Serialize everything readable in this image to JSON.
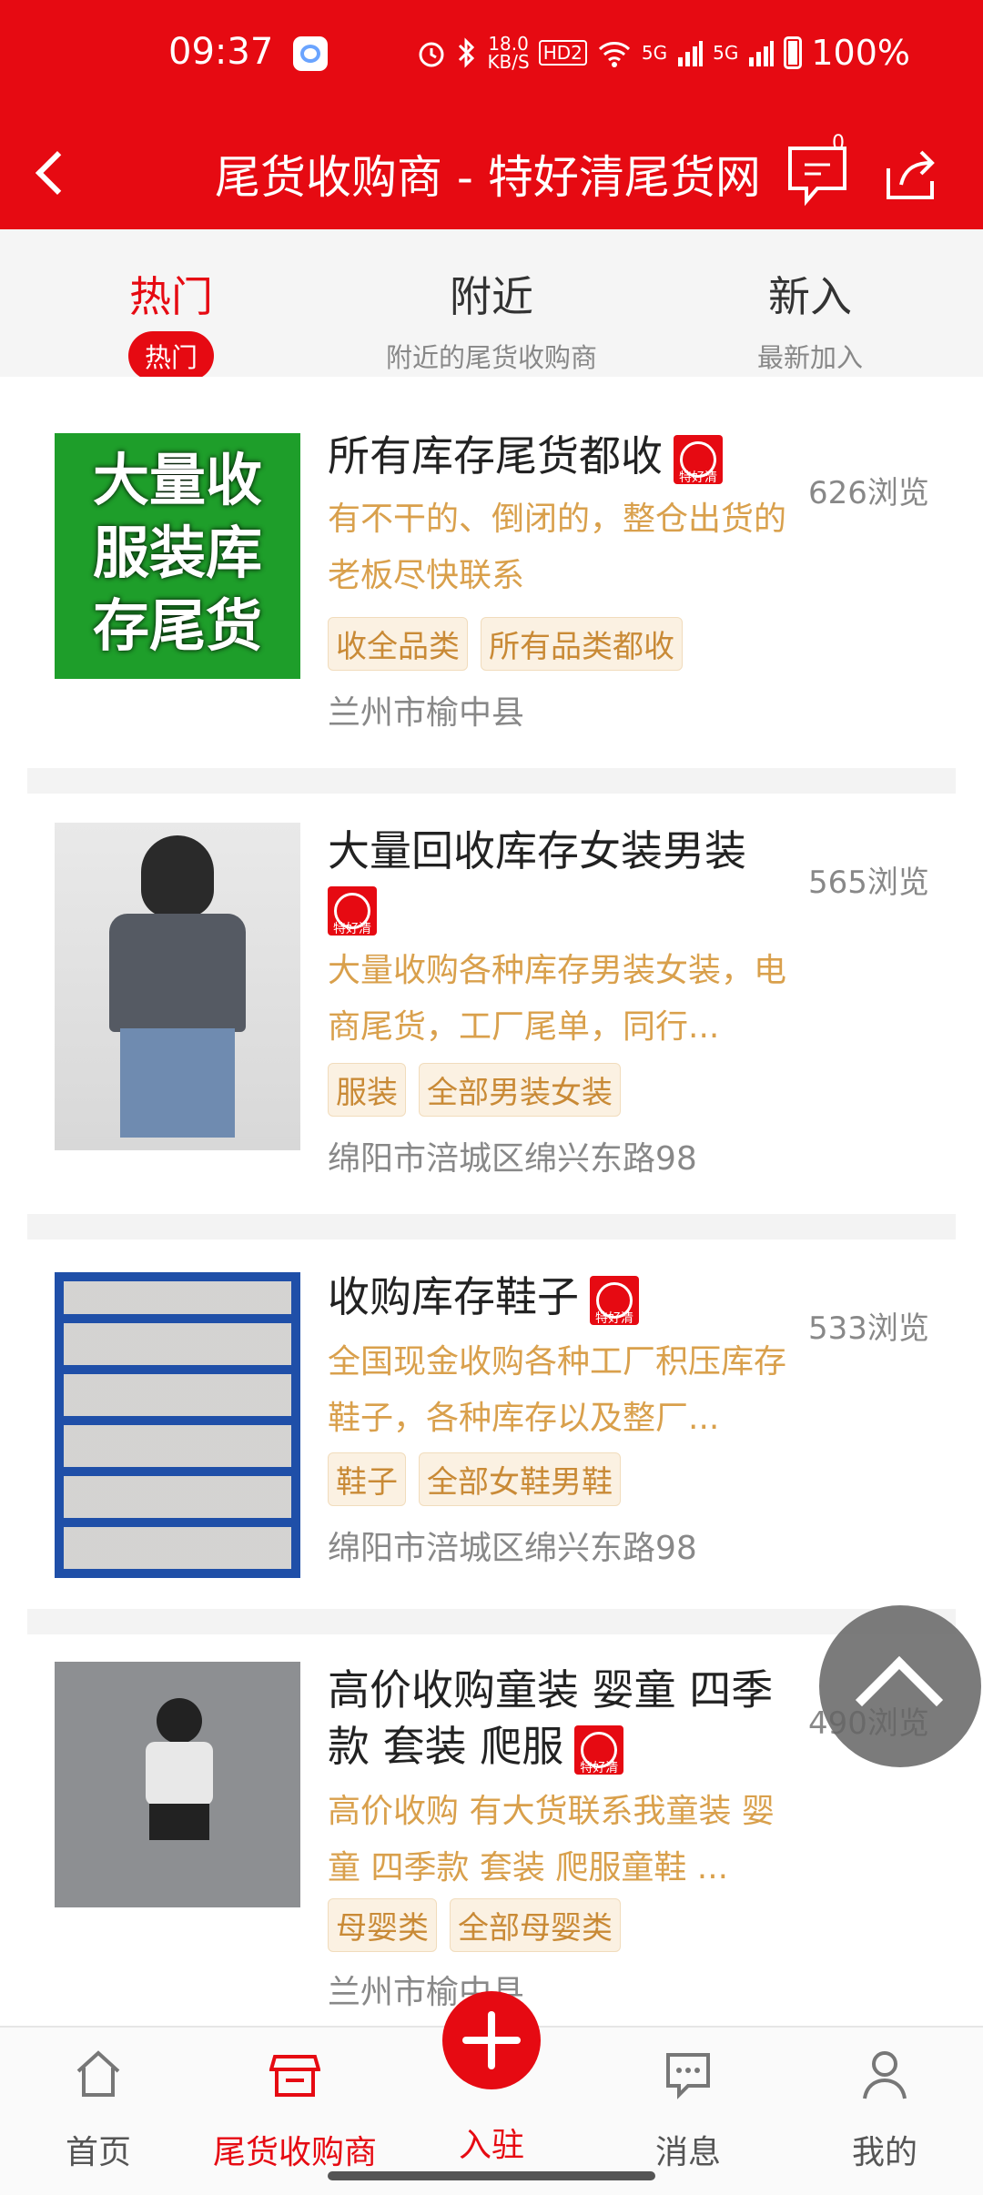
{
  "status": {
    "time": "09:37",
    "speed": "18.0",
    "speed_unit": "KB/S",
    "hd": "HD2",
    "net1": "5G",
    "net2": "5G",
    "battery": "100%"
  },
  "header": {
    "title": "尾货收购商 - 特好清尾货网",
    "msg_badge": "0"
  },
  "tabs": [
    {
      "label": "热门",
      "sub": "热门"
    },
    {
      "label": "附近",
      "sub": "附近的尾货收购商"
    },
    {
      "label": "新入",
      "sub": "最新加入"
    }
  ],
  "badge_text": "特好清",
  "items": [
    {
      "title": "所有库存尾货都收",
      "desc": "有不干的、倒闭的，整仓出货的老板尽快联系",
      "tags": [
        "收全品类",
        "所有品类都收"
      ],
      "location": "兰州市榆中县",
      "views": "626浏览",
      "thumb_text": [
        "大量收",
        "服装库",
        "存尾货"
      ]
    },
    {
      "title": "大量回收库存女装男装",
      "desc": "大量收购各种库存男装女装，电商尾货，工厂尾单，同行...",
      "tags": [
        "服装",
        "全部男装女装"
      ],
      "location": "绵阳市涪城区绵兴东路98",
      "views": "565浏览"
    },
    {
      "title": "收购库存鞋子",
      "desc": "全国现金收购各种工厂积压库存鞋子，各种库存以及整厂...",
      "tags": [
        "鞋子",
        "全部女鞋男鞋"
      ],
      "location": "绵阳市涪城区绵兴东路98",
      "views": "533浏览"
    },
    {
      "title": "高价收购童装 婴童 四季款 套装 爬服",
      "desc": "高价收购 有大货联系我童装 婴童 四季款 套装 爬服童鞋 ...",
      "tags": [
        "母婴类",
        "全部母婴类"
      ],
      "location": "兰州市榆中县",
      "views": "490浏览"
    }
  ],
  "bottom_nav": [
    {
      "label": "首页"
    },
    {
      "label": "尾货收购商"
    },
    {
      "label": "入驻"
    },
    {
      "label": "消息"
    },
    {
      "label": "我的"
    }
  ],
  "colors": {
    "brand": "#e60a12",
    "desc": "#d9a04c",
    "tag_bg": "#fbf1e2"
  }
}
